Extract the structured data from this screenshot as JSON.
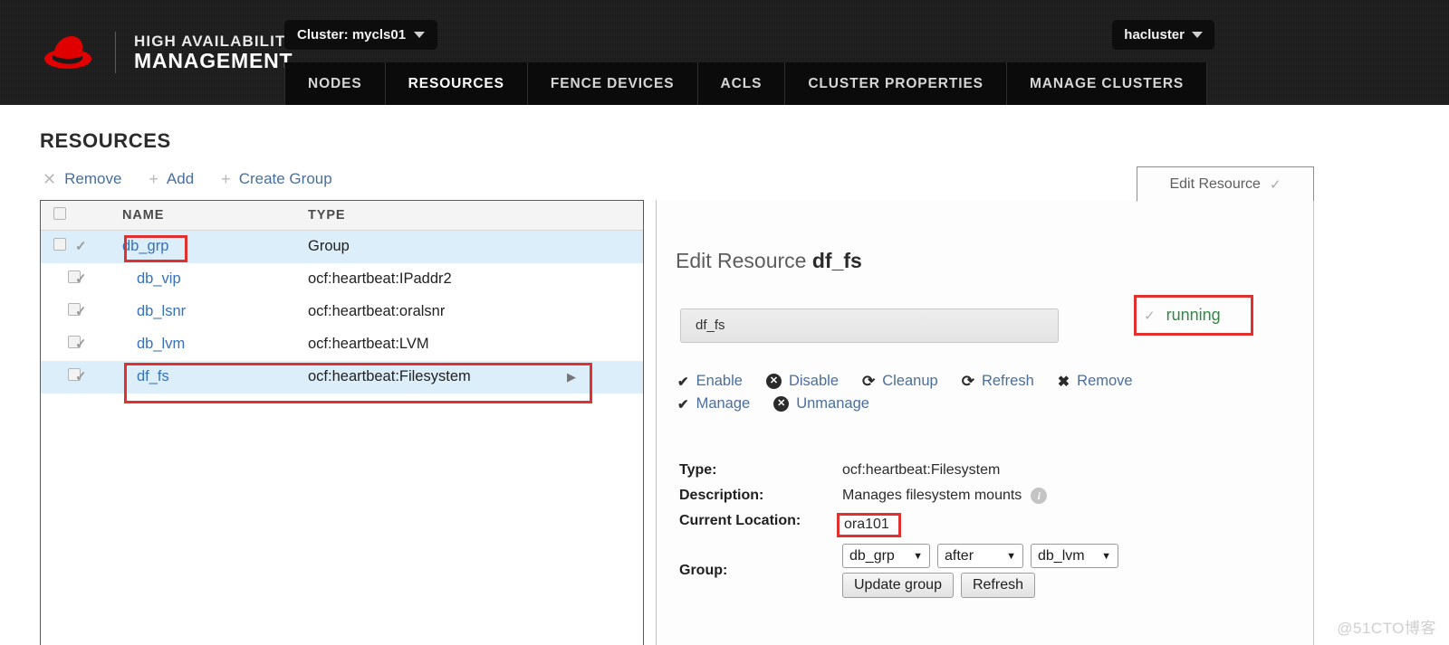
{
  "header": {
    "brand_line1": "HIGH AVAILABILITY",
    "brand_line2": "MANAGEMENT",
    "cluster_pill": "Cluster: mycls01",
    "user_pill": "hacluster",
    "nav": [
      {
        "label": "NODES",
        "active": false
      },
      {
        "label": "RESOURCES",
        "active": true
      },
      {
        "label": "FENCE DEVICES",
        "active": false
      },
      {
        "label": "ACLS",
        "active": false
      },
      {
        "label": "CLUSTER PROPERTIES",
        "active": false
      },
      {
        "label": "MANAGE CLUSTERS",
        "active": false
      }
    ]
  },
  "page": {
    "title": "RESOURCES",
    "toolbar": {
      "remove": "Remove",
      "add": "Add",
      "create_group": "Create Group",
      "remove_icon": "✕",
      "add_icon": "+",
      "create_group_icon": "+"
    }
  },
  "table": {
    "headers": {
      "name": "NAME",
      "type": "TYPE"
    },
    "rows": [
      {
        "name": "db_grp",
        "type": "Group",
        "indent": 0,
        "selected": true,
        "expandable": false
      },
      {
        "name": "db_vip",
        "type": "ocf:heartbeat:IPaddr2",
        "indent": 1,
        "selected": false,
        "expandable": false
      },
      {
        "name": "db_lsnr",
        "type": "ocf:heartbeat:oralsnr",
        "indent": 1,
        "selected": false,
        "expandable": false
      },
      {
        "name": "db_lvm",
        "type": "ocf:heartbeat:LVM",
        "indent": 1,
        "selected": false,
        "expandable": false
      },
      {
        "name": "df_fs",
        "type": "ocf:heartbeat:Filesystem",
        "indent": 1,
        "selected": true,
        "expandable": true
      }
    ]
  },
  "panel": {
    "tab_label": "Edit Resource",
    "heading_prefix": "Edit Resource ",
    "heading_resource": "df_fs",
    "name_value": "df_fs",
    "status_text": "running",
    "status_color": "#2e8b3f",
    "actions": [
      {
        "label": "Enable",
        "icon": "check"
      },
      {
        "label": "Disable",
        "icon": "x-circle"
      },
      {
        "label": "Cleanup",
        "icon": "refresh"
      },
      {
        "label": "Refresh",
        "icon": "refresh"
      },
      {
        "label": "Remove",
        "icon": "x"
      }
    ],
    "actions_row2": [
      {
        "label": "Manage",
        "icon": "check"
      },
      {
        "label": "Unmanage",
        "icon": "x-circle"
      }
    ],
    "details": {
      "type_label": "Type:",
      "type_value": "ocf:heartbeat:Filesystem",
      "description_label": "Description:",
      "description_value": "Manages filesystem mounts",
      "location_label": "Current Location:",
      "location_value": "ora101",
      "group_label": "Group:",
      "group_select": "db_grp",
      "order_select": "after",
      "target_select": "db_lvm",
      "update_button": "Update group",
      "refresh_button": "Refresh"
    }
  },
  "watermark": "@51CTO博客",
  "colors": {
    "link": "#4a6f9c",
    "highlight_border": "#e03131",
    "row_selected_bg": "#ddeefb",
    "brand_red": "#e00000"
  }
}
